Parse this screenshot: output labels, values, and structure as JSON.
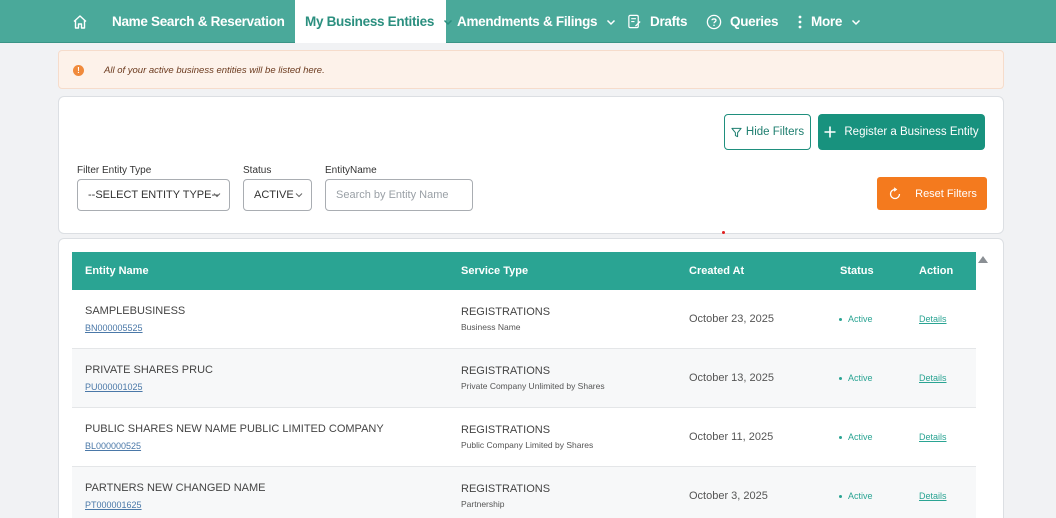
{
  "nav": {
    "home_icon": "home-icon",
    "items": [
      {
        "label": "Name Search & Reservation"
      },
      {
        "label": "My Business Entities"
      },
      {
        "label": "Amendments & Filings"
      },
      {
        "label": "Drafts"
      },
      {
        "label": "Queries"
      },
      {
        "label": "More"
      }
    ]
  },
  "alert": {
    "icon": "alert-icon",
    "text": "All of your active business entities will be listed here."
  },
  "filters": {
    "hide_label": "Hide Filters",
    "register_label": "Register a Business Entity",
    "entity_type_label": "Filter Entity Type",
    "entity_type_value": "--SELECT ENTITY TYPE--",
    "status_label": "Status",
    "status_value": "ACTIVE",
    "entity_name_label": "EntityName",
    "entity_name_placeholder": "Search by Entity Name",
    "reset_label": "Reset Filters"
  },
  "table": {
    "headers": [
      "Entity Name",
      "Service Type",
      "Created At",
      "Status",
      "Action"
    ],
    "rows": [
      {
        "name": "SAMPLEBUSINESS",
        "code": "BN000005525",
        "service": "REGISTRATIONS",
        "service_sub": "Business Name",
        "created": "October 23, 2025",
        "status": "Active",
        "action": "Details"
      },
      {
        "name": "PRIVATE SHARES PRUC",
        "code": "PU000001025",
        "service": "REGISTRATIONS",
        "service_sub": "Private Company Unlimited by Shares",
        "created": "October 13, 2025",
        "status": "Active",
        "action": "Details"
      },
      {
        "name": "PUBLIC SHARES NEW NAME PUBLIC LIMITED COMPANY",
        "code": "BL000000525",
        "service": "REGISTRATIONS",
        "service_sub": "Public Company Limited by Shares",
        "created": "October 11, 2025",
        "status": "Active",
        "action": "Details"
      },
      {
        "name": "PARTNERS NEW CHANGED NAME",
        "code": "PT000001625",
        "service": "REGISTRATIONS",
        "service_sub": "Partnership",
        "created": "October 3, 2025",
        "status": "Active",
        "action": "Details"
      }
    ]
  },
  "colors": {
    "nav_bg": "#4aa99a",
    "primary": "#18927e",
    "table_header": "#2aa493",
    "reset": "#f47a1e",
    "alert_bg": "#fdf2ea"
  }
}
